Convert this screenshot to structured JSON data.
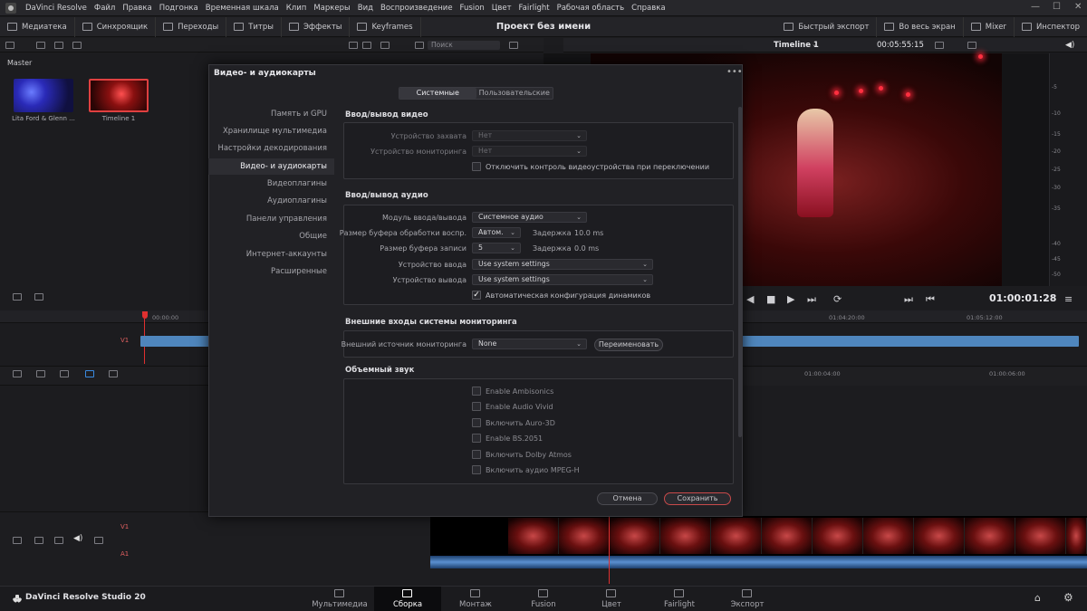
{
  "menubar": {
    "app_name": "DaVinci Resolve",
    "items": [
      "Файл",
      "Правка",
      "Подгонка",
      "Временная шкала",
      "Клип",
      "Маркеры",
      "Вид",
      "Воспроизведение",
      "Fusion",
      "Цвет",
      "Fairlight",
      "Рабочая область",
      "Справка"
    ]
  },
  "toolbar": {
    "left": [
      "Медиатека",
      "Синхроящик",
      "Переходы",
      "Титры",
      "Эффекты",
      "Keyframes"
    ],
    "project_title": "Проект без имени",
    "right": [
      "Быстрый экспорт",
      "Во весь экран",
      "Mixer",
      "Инспектор"
    ]
  },
  "mediapool": {
    "search_placeholder": "Поиск",
    "bin": "Master",
    "clips": [
      {
        "label": "Lita Ford & Glenn ..."
      },
      {
        "label": "Timeline 1"
      }
    ]
  },
  "viewer": {
    "timeline_name": "Timeline 1",
    "duration": "00:05:55:15",
    "timecode": "01:00:01:28",
    "meter_ticks": [
      "-5",
      "-10",
      "-15",
      "-20",
      "-25",
      "-30",
      "-35",
      "-40",
      "-45",
      "-50"
    ]
  },
  "timeline": {
    "ruler_top": [
      "00:00:00",
      "01:04:20:00",
      "01:05:12:00"
    ],
    "ruler_low": [
      "01:00:04:00",
      "01:00:06:00"
    ],
    "track_v1": "V1",
    "track_a1": "A1"
  },
  "dialog": {
    "title": "Видео- и аудиокарты",
    "tabs": [
      "Системные",
      "Пользовательские"
    ],
    "nav": [
      "Память и GPU",
      "Хранилище мультимедиа",
      "Настройки декодирования",
      "Видео- и аудиокарты",
      "Видеоплагины",
      "Аудиоплагины",
      "Панели управления",
      "Общие",
      "Интернет-аккаунты",
      "Расширенные"
    ],
    "video_io": {
      "header": "Ввод/вывод видео",
      "capture_label": "Устройство захвата",
      "capture_value": "Нет",
      "monitor_label": "Устройство мониторинга",
      "monitor_value": "Нет",
      "disable_label": "Отключить контроль видеоустройства при переключении"
    },
    "audio_io": {
      "header": "Ввод/вывод аудио",
      "module_label": "Модуль ввода/вывода",
      "module_value": "Системное аудио",
      "playback_buffer_label": "Размер буфера обработки воспр.",
      "playback_buffer_value": "Автом.",
      "latency_label": "Задержка",
      "playback_latency": "10.0 ms",
      "record_buffer_label": "Размер буфера записи",
      "record_buffer_value": "5",
      "record_latency": "0.0 ms",
      "input_label": "Устройство ввода",
      "input_value": "Use system settings",
      "output_label": "Устройство вывода",
      "output_value": "Use system settings",
      "auto_speaker_label": "Автоматическая конфигурация динамиков"
    },
    "monitor_inputs": {
      "header": "Внешние входы системы мониторинга",
      "source_label": "Внешний источник мониторинга",
      "source_value": "None",
      "rename_button": "Переименовать"
    },
    "surround": {
      "header": "Объемный звук",
      "options": [
        "Enable Ambisonics",
        "Enable Audio Vivid",
        "Включить Auro-3D",
        "Enable BS.2051",
        "Включить Dolby Atmos",
        "Включить аудио MPEG-H"
      ]
    },
    "cancel_button": "Отмена",
    "save_button": "Сохранить"
  },
  "bottom": {
    "brand": "DaVinci Resolve Studio 20",
    "pages": [
      "Мультимедиа",
      "Сборка",
      "Монтаж",
      "Fusion",
      "Цвет",
      "Fairlight",
      "Экспорт"
    ]
  },
  "colors": {
    "accent_red": "#e03030",
    "clip_blue": "#4f86bd"
  }
}
